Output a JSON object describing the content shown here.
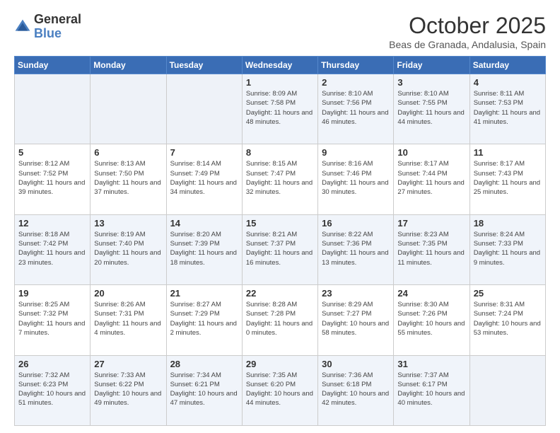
{
  "header": {
    "logo_line1": "General",
    "logo_line2": "Blue",
    "month_title": "October 2025",
    "location": "Beas de Granada, Andalusia, Spain"
  },
  "days_of_week": [
    "Sunday",
    "Monday",
    "Tuesday",
    "Wednesday",
    "Thursday",
    "Friday",
    "Saturday"
  ],
  "weeks": [
    [
      {
        "num": "",
        "info": ""
      },
      {
        "num": "",
        "info": ""
      },
      {
        "num": "",
        "info": ""
      },
      {
        "num": "1",
        "info": "Sunrise: 8:09 AM\nSunset: 7:58 PM\nDaylight: 11 hours and 48 minutes."
      },
      {
        "num": "2",
        "info": "Sunrise: 8:10 AM\nSunset: 7:56 PM\nDaylight: 11 hours and 46 minutes."
      },
      {
        "num": "3",
        "info": "Sunrise: 8:10 AM\nSunset: 7:55 PM\nDaylight: 11 hours and 44 minutes."
      },
      {
        "num": "4",
        "info": "Sunrise: 8:11 AM\nSunset: 7:53 PM\nDaylight: 11 hours and 41 minutes."
      }
    ],
    [
      {
        "num": "5",
        "info": "Sunrise: 8:12 AM\nSunset: 7:52 PM\nDaylight: 11 hours and 39 minutes."
      },
      {
        "num": "6",
        "info": "Sunrise: 8:13 AM\nSunset: 7:50 PM\nDaylight: 11 hours and 37 minutes."
      },
      {
        "num": "7",
        "info": "Sunrise: 8:14 AM\nSunset: 7:49 PM\nDaylight: 11 hours and 34 minutes."
      },
      {
        "num": "8",
        "info": "Sunrise: 8:15 AM\nSunset: 7:47 PM\nDaylight: 11 hours and 32 minutes."
      },
      {
        "num": "9",
        "info": "Sunrise: 8:16 AM\nSunset: 7:46 PM\nDaylight: 11 hours and 30 minutes."
      },
      {
        "num": "10",
        "info": "Sunrise: 8:17 AM\nSunset: 7:44 PM\nDaylight: 11 hours and 27 minutes."
      },
      {
        "num": "11",
        "info": "Sunrise: 8:17 AM\nSunset: 7:43 PM\nDaylight: 11 hours and 25 minutes."
      }
    ],
    [
      {
        "num": "12",
        "info": "Sunrise: 8:18 AM\nSunset: 7:42 PM\nDaylight: 11 hours and 23 minutes."
      },
      {
        "num": "13",
        "info": "Sunrise: 8:19 AM\nSunset: 7:40 PM\nDaylight: 11 hours and 20 minutes."
      },
      {
        "num": "14",
        "info": "Sunrise: 8:20 AM\nSunset: 7:39 PM\nDaylight: 11 hours and 18 minutes."
      },
      {
        "num": "15",
        "info": "Sunrise: 8:21 AM\nSunset: 7:37 PM\nDaylight: 11 hours and 16 minutes."
      },
      {
        "num": "16",
        "info": "Sunrise: 8:22 AM\nSunset: 7:36 PM\nDaylight: 11 hours and 13 minutes."
      },
      {
        "num": "17",
        "info": "Sunrise: 8:23 AM\nSunset: 7:35 PM\nDaylight: 11 hours and 11 minutes."
      },
      {
        "num": "18",
        "info": "Sunrise: 8:24 AM\nSunset: 7:33 PM\nDaylight: 11 hours and 9 minutes."
      }
    ],
    [
      {
        "num": "19",
        "info": "Sunrise: 8:25 AM\nSunset: 7:32 PM\nDaylight: 11 hours and 7 minutes."
      },
      {
        "num": "20",
        "info": "Sunrise: 8:26 AM\nSunset: 7:31 PM\nDaylight: 11 hours and 4 minutes."
      },
      {
        "num": "21",
        "info": "Sunrise: 8:27 AM\nSunset: 7:29 PM\nDaylight: 11 hours and 2 minutes."
      },
      {
        "num": "22",
        "info": "Sunrise: 8:28 AM\nSunset: 7:28 PM\nDaylight: 11 hours and 0 minutes."
      },
      {
        "num": "23",
        "info": "Sunrise: 8:29 AM\nSunset: 7:27 PM\nDaylight: 10 hours and 58 minutes."
      },
      {
        "num": "24",
        "info": "Sunrise: 8:30 AM\nSunset: 7:26 PM\nDaylight: 10 hours and 55 minutes."
      },
      {
        "num": "25",
        "info": "Sunrise: 8:31 AM\nSunset: 7:24 PM\nDaylight: 10 hours and 53 minutes."
      }
    ],
    [
      {
        "num": "26",
        "info": "Sunrise: 7:32 AM\nSunset: 6:23 PM\nDaylight: 10 hours and 51 minutes."
      },
      {
        "num": "27",
        "info": "Sunrise: 7:33 AM\nSunset: 6:22 PM\nDaylight: 10 hours and 49 minutes."
      },
      {
        "num": "28",
        "info": "Sunrise: 7:34 AM\nSunset: 6:21 PM\nDaylight: 10 hours and 47 minutes."
      },
      {
        "num": "29",
        "info": "Sunrise: 7:35 AM\nSunset: 6:20 PM\nDaylight: 10 hours and 44 minutes."
      },
      {
        "num": "30",
        "info": "Sunrise: 7:36 AM\nSunset: 6:18 PM\nDaylight: 10 hours and 42 minutes."
      },
      {
        "num": "31",
        "info": "Sunrise: 7:37 AM\nSunset: 6:17 PM\nDaylight: 10 hours and 40 minutes."
      },
      {
        "num": "",
        "info": ""
      }
    ]
  ]
}
